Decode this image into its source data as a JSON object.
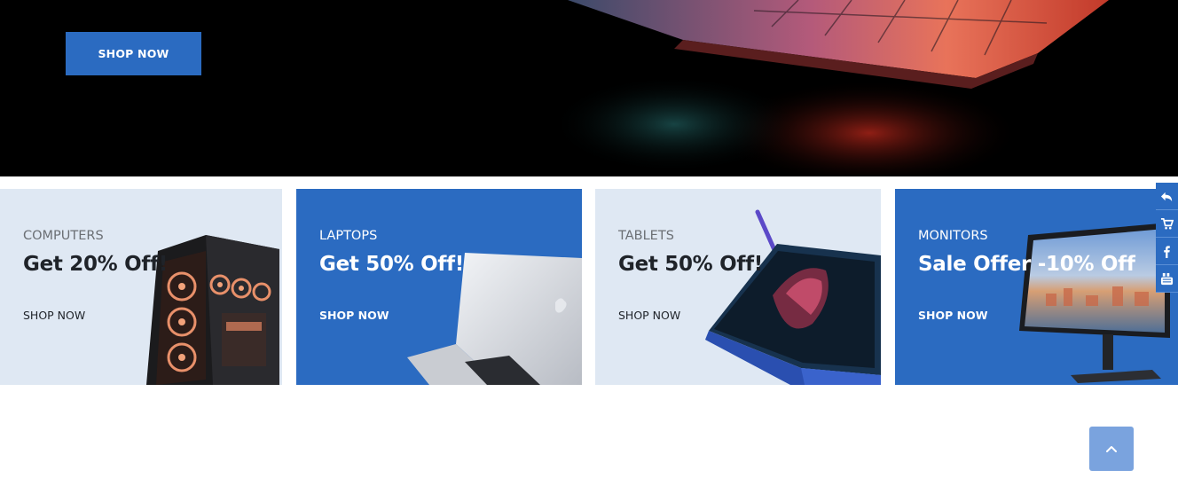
{
  "hero": {
    "button_label": "SHOP NOW"
  },
  "categories": [
    {
      "category": "COMPUTERS",
      "headline": "Get 20% Off!",
      "link": "SHOP NOW"
    },
    {
      "category": "LAPTOPS",
      "headline": "Get 50% Off!",
      "link": "SHOP NOW"
    },
    {
      "category": "TABLETS",
      "headline": "Get 50% Off!",
      "link": "SHOP NOW"
    },
    {
      "category": "MONITORS",
      "headline": "Sale Offer -10% Off",
      "link": "SHOP NOW"
    }
  ],
  "side_icons": [
    "back-arrow-icon",
    "cart-icon",
    "facebook-icon",
    "youtube-icon"
  ],
  "colors": {
    "brand_blue": "#2b6bc1",
    "card_light": "#dfe8f3",
    "to_top": "#7aa3de"
  }
}
